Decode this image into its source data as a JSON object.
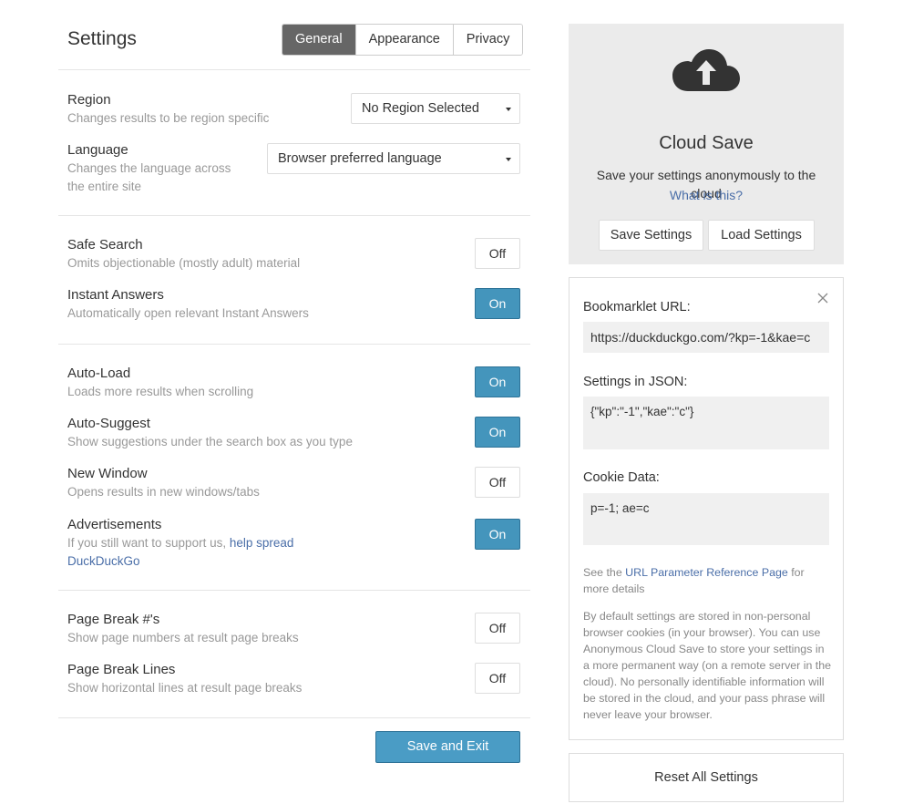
{
  "header": {
    "title": "Settings",
    "tabs": [
      {
        "label": "General",
        "active": true
      },
      {
        "label": "Appearance",
        "active": false
      },
      {
        "label": "Privacy",
        "active": false
      }
    ]
  },
  "general": {
    "region": {
      "label": "Region",
      "desc": "Changes results to be region specific",
      "value": "No Region Selected"
    },
    "language": {
      "label": "Language",
      "desc_line1": "Changes the language across",
      "desc_line2": "the entire site",
      "value": "Browser preferred language"
    },
    "safe_search": {
      "label": "Safe Search",
      "desc": "Omits objectionable (mostly adult) material",
      "state": "Off"
    },
    "instant_answers": {
      "label": "Instant Answers",
      "desc": "Automatically open relevant Instant Answers",
      "state": "On"
    },
    "auto_load": {
      "label": "Auto-Load",
      "desc": "Loads more results when scrolling",
      "state": "On"
    },
    "auto_suggest": {
      "label": "Auto-Suggest",
      "desc": "Show suggestions under the search box as you type",
      "state": "On"
    },
    "new_window": {
      "label": "New Window",
      "desc": "Opens results in new windows/tabs",
      "state": "Off"
    },
    "advertisements": {
      "label": "Advertisements",
      "desc_prefix": "If you still want to support us, ",
      "link_part1": "help spread",
      "link_part2": "DuckDuckGo",
      "state": "On"
    },
    "page_break_numbers": {
      "label": "Page Break #'s",
      "desc": "Show page numbers at result page breaks",
      "state": "Off"
    },
    "page_break_lines": {
      "label": "Page Break Lines",
      "desc": "Show horizontal lines at result page breaks",
      "state": "Off"
    },
    "save_exit_label": "Save and Exit"
  },
  "cloud_save": {
    "icon": "cloud-upload-icon",
    "title": "Cloud Save",
    "desc": "Save your settings anonymously to the cloud",
    "what_link": "What is this?",
    "save_button": "Save Settings",
    "load_button": "Load Settings"
  },
  "bookmarklet_panel": {
    "url_label": "Bookmarklet URL:",
    "url_value": "https://duckduckgo.com/?kp=-1&kae=c",
    "json_label": "Settings in JSON:",
    "json_value": "{\"kp\":\"-1\",\"kae\":\"c\"}",
    "cookie_label": "Cookie Data:",
    "cookie_value": "p=-1; ae=c",
    "see_prefix": "See the ",
    "see_link": "URL Parameter Reference Page",
    "see_suffix": " for more details",
    "note": "By default settings are stored in non-personal browser cookies (in your browser). You can use Anonymous Cloud Save to store your settings in a more permanent way (on a remote server in the cloud). No personally identifiable information will be stored in the cloud, and your pass phrase will never leave your browser."
  },
  "reset_label": "Reset All Settings",
  "colors": {
    "accent": "#4495bc",
    "tab_active": "#666666",
    "link": "#4a6ea8",
    "cloud_bg": "#ebebeb"
  }
}
